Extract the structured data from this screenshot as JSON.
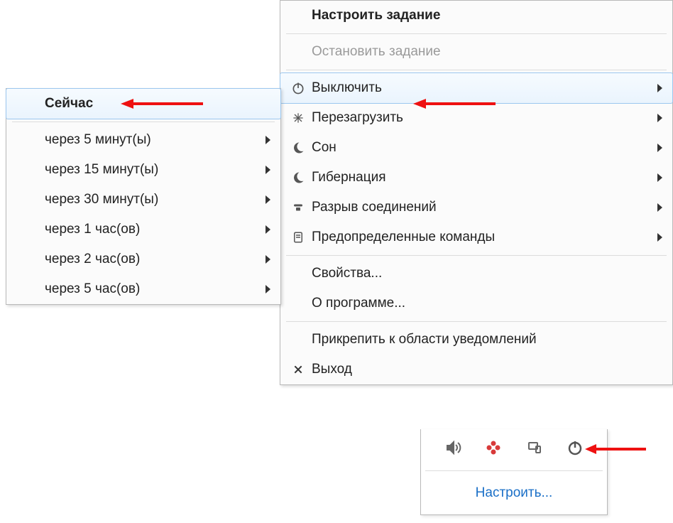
{
  "mainmenu": {
    "configure": "Настроить задание",
    "stop": "Остановить задание",
    "shutdown": "Выключить",
    "restart": "Перезагрузить",
    "sleep": "Сон",
    "hibernate": "Гибернация",
    "disconnect": "Разрыв соединений",
    "predefined": "Предопределенные команды",
    "properties": "Свойства...",
    "about": "О программе...",
    "pin": "Прикрепить к области уведомлений",
    "exit": "Выход"
  },
  "submenu": {
    "now": "Сейчас",
    "m5": "через 5 минут(ы)",
    "m15": "через 15 минут(ы)",
    "m30": "через 30 минут(ы)",
    "h1": "через 1 час(ов)",
    "h2": "через 2 час(ов)",
    "h5": "через 5 час(ов)"
  },
  "tray": {
    "customize": "Настроить..."
  }
}
